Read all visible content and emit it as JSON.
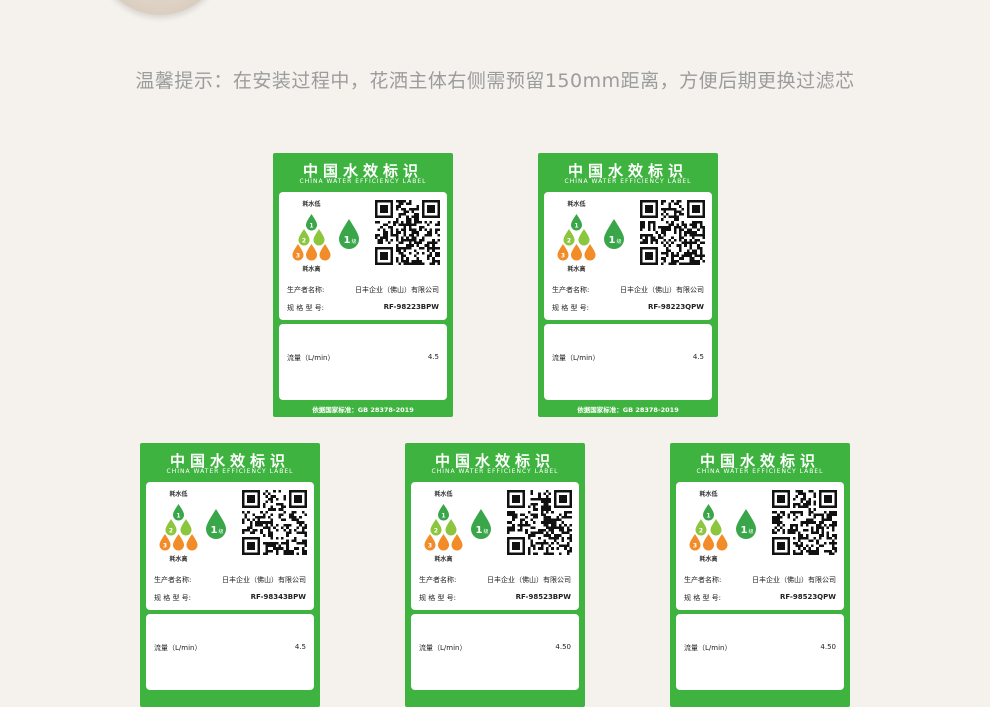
{
  "tip": "温馨提示：在安装过程中，花洒主体右侧需预留150mm距离，方便后期更换过滤芯",
  "colors": {
    "label_green": "#3fb33f",
    "grade1": "#3aa64a",
    "grade2": "#8cc63f",
    "grade3": "#f28c28"
  },
  "labels": [
    {
      "title": "中国水效标识",
      "subtitle": "CHINA WATER EFFICIENCY LABEL",
      "low": "耗水低",
      "high": "耗水高",
      "grade": "1",
      "grade_suffix": "级",
      "scale": [
        "1",
        "2",
        "3"
      ],
      "maker_label": "生产者名称:",
      "maker": "日丰企业（佛山）有限公司",
      "model_label": "规 格 型 号:",
      "model": "RF-98223BPW",
      "flow_label": "流量（L/min）",
      "flow": "4.5",
      "standard": "依据国家标准：GB 28378-2019"
    },
    {
      "title": "中国水效标识",
      "subtitle": "CHINA WATER EFFICIENCY LABEL",
      "low": "耗水低",
      "high": "耗水高",
      "grade": "1",
      "grade_suffix": "级",
      "scale": [
        "1",
        "2",
        "3"
      ],
      "maker_label": "生产者名称:",
      "maker": "日丰企业（佛山）有限公司",
      "model_label": "规 格 型 号:",
      "model": "RF-98223QPW",
      "flow_label": "流量（L/min）",
      "flow": "4.5",
      "standard": "依据国家标准：GB 28378-2019"
    },
    {
      "title": "中国水效标识",
      "subtitle": "CHINA WATER EFFICIENCY LABEL",
      "low": "耗水低",
      "high": "耗水高",
      "grade": "1",
      "grade_suffix": "级",
      "scale": [
        "1",
        "2",
        "3"
      ],
      "maker_label": "生产者名称:",
      "maker": "日丰企业（佛山）有限公司",
      "model_label": "规 格 型 号:",
      "model": "RF-98343BPW",
      "flow_label": "流量（L/min）",
      "flow": "4.5",
      "standard": ""
    },
    {
      "title": "中国水效标识",
      "subtitle": "CHINA WATER EFFICIENCY LABEL",
      "low": "耗水低",
      "high": "耗水高",
      "grade": "1",
      "grade_suffix": "级",
      "scale": [
        "1",
        "2",
        "3"
      ],
      "maker_label": "生产者名称:",
      "maker": "日丰企业（佛山）有限公司",
      "model_label": "规 格 型 号:",
      "model": "RF-98523BPW",
      "flow_label": "流量（L/min）",
      "flow": "4.50",
      "standard": ""
    },
    {
      "title": "中国水效标识",
      "subtitle": "CHINA WATER EFFICIENCY LABEL",
      "low": "耗水低",
      "high": "耗水高",
      "grade": "1",
      "grade_suffix": "级",
      "scale": [
        "1",
        "2",
        "3"
      ],
      "maker_label": "生产者名称:",
      "maker": "日丰企业（佛山）有限公司",
      "model_label": "规 格 型 号:",
      "model": "RF-98523QPW",
      "flow_label": "流量（L/min）",
      "flow": "4.50",
      "standard": ""
    }
  ]
}
